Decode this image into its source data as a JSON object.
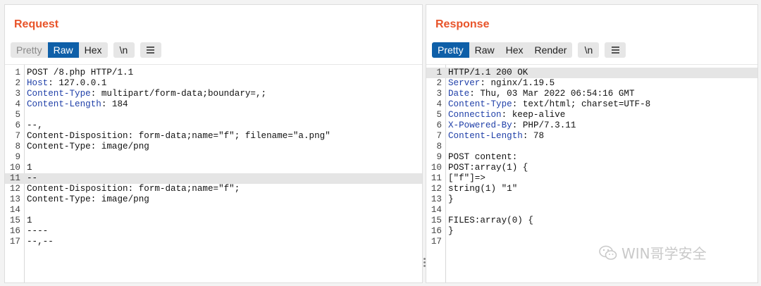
{
  "request": {
    "title": "Request",
    "tabs": [
      {
        "label": "Pretty",
        "state": "dim"
      },
      {
        "label": "Raw",
        "state": "active"
      },
      {
        "label": "Hex",
        "state": "normal"
      }
    ],
    "newline_button": "\\n",
    "lines": [
      {
        "n": "1",
        "key": "",
        "val": "POST /8.php HTTP/1.1"
      },
      {
        "n": "2",
        "key": "Host",
        "val": " 127.0.0.1"
      },
      {
        "n": "3",
        "key": "Content-Type",
        "val": " multipart/form-data;boundary=,;"
      },
      {
        "n": "4",
        "key": "Content-Length",
        "val": " 184"
      },
      {
        "n": "5",
        "key": "",
        "val": ""
      },
      {
        "n": "6",
        "key": "",
        "val": "--,"
      },
      {
        "n": "7",
        "key": "",
        "val": "Content-Disposition: form-data;name=\"f\"; filename=\"a.png\""
      },
      {
        "n": "8",
        "key": "",
        "val": "Content-Type: image/png"
      },
      {
        "n": "9",
        "key": "",
        "val": ""
      },
      {
        "n": "10",
        "key": "",
        "val": "1"
      },
      {
        "n": "11",
        "key": "",
        "val": "--"
      },
      {
        "n": "12",
        "key": "",
        "val": "Content-Disposition: form-data;name=\"f\";"
      },
      {
        "n": "13",
        "key": "",
        "val": "Content-Type: image/png"
      },
      {
        "n": "14",
        "key": "",
        "val": ""
      },
      {
        "n": "15",
        "key": "",
        "val": "1"
      },
      {
        "n": "16",
        "key": "",
        "val": "----"
      },
      {
        "n": "17",
        "key": "",
        "val": "--,--"
      }
    ],
    "highlighted_line": "11"
  },
  "response": {
    "title": "Response",
    "tabs": [
      {
        "label": "Pretty",
        "state": "active"
      },
      {
        "label": "Raw",
        "state": "normal"
      },
      {
        "label": "Hex",
        "state": "normal"
      },
      {
        "label": "Render",
        "state": "normal"
      }
    ],
    "newline_button": "\\n",
    "lines": [
      {
        "n": "1",
        "key": "",
        "val": "HTTP/1.1 200 OK"
      },
      {
        "n": "2",
        "key": "Server",
        "val": " nginx/1.19.5"
      },
      {
        "n": "3",
        "key": "Date",
        "val": " Thu, 03 Mar 2022 06:54:16 GMT"
      },
      {
        "n": "4",
        "key": "Content-Type",
        "val": " text/html; charset=UTF-8"
      },
      {
        "n": "5",
        "key": "Connection",
        "val": " keep-alive"
      },
      {
        "n": "6",
        "key": "X-Powered-By",
        "val": " PHP/7.3.11"
      },
      {
        "n": "7",
        "key": "Content-Length",
        "val": " 78"
      },
      {
        "n": "8",
        "key": "",
        "val": ""
      },
      {
        "n": "9",
        "key": "",
        "val": "POST content:"
      },
      {
        "n": "10",
        "key": "",
        "val": "POST:array(1) {"
      },
      {
        "n": "11",
        "key": "",
        "val": "[\"f\"]=>"
      },
      {
        "n": "12",
        "key": "",
        "val": "string(1) \"1\""
      },
      {
        "n": "13",
        "key": "",
        "val": "}"
      },
      {
        "n": "14",
        "key": "",
        "val": ""
      },
      {
        "n": "15",
        "key": "",
        "val": "FILES:array(0) {"
      },
      {
        "n": "16",
        "key": "",
        "val": "}"
      },
      {
        "n": "17",
        "key": "",
        "val": ""
      }
    ],
    "highlighted_line": "1"
  },
  "watermark": {
    "text": "WIN哥学安全",
    "icon": "wechat-icon"
  },
  "colors": {
    "accent": "#e8542a",
    "active_tab": "#0e5fa8",
    "header_key": "#1f3fa8"
  }
}
